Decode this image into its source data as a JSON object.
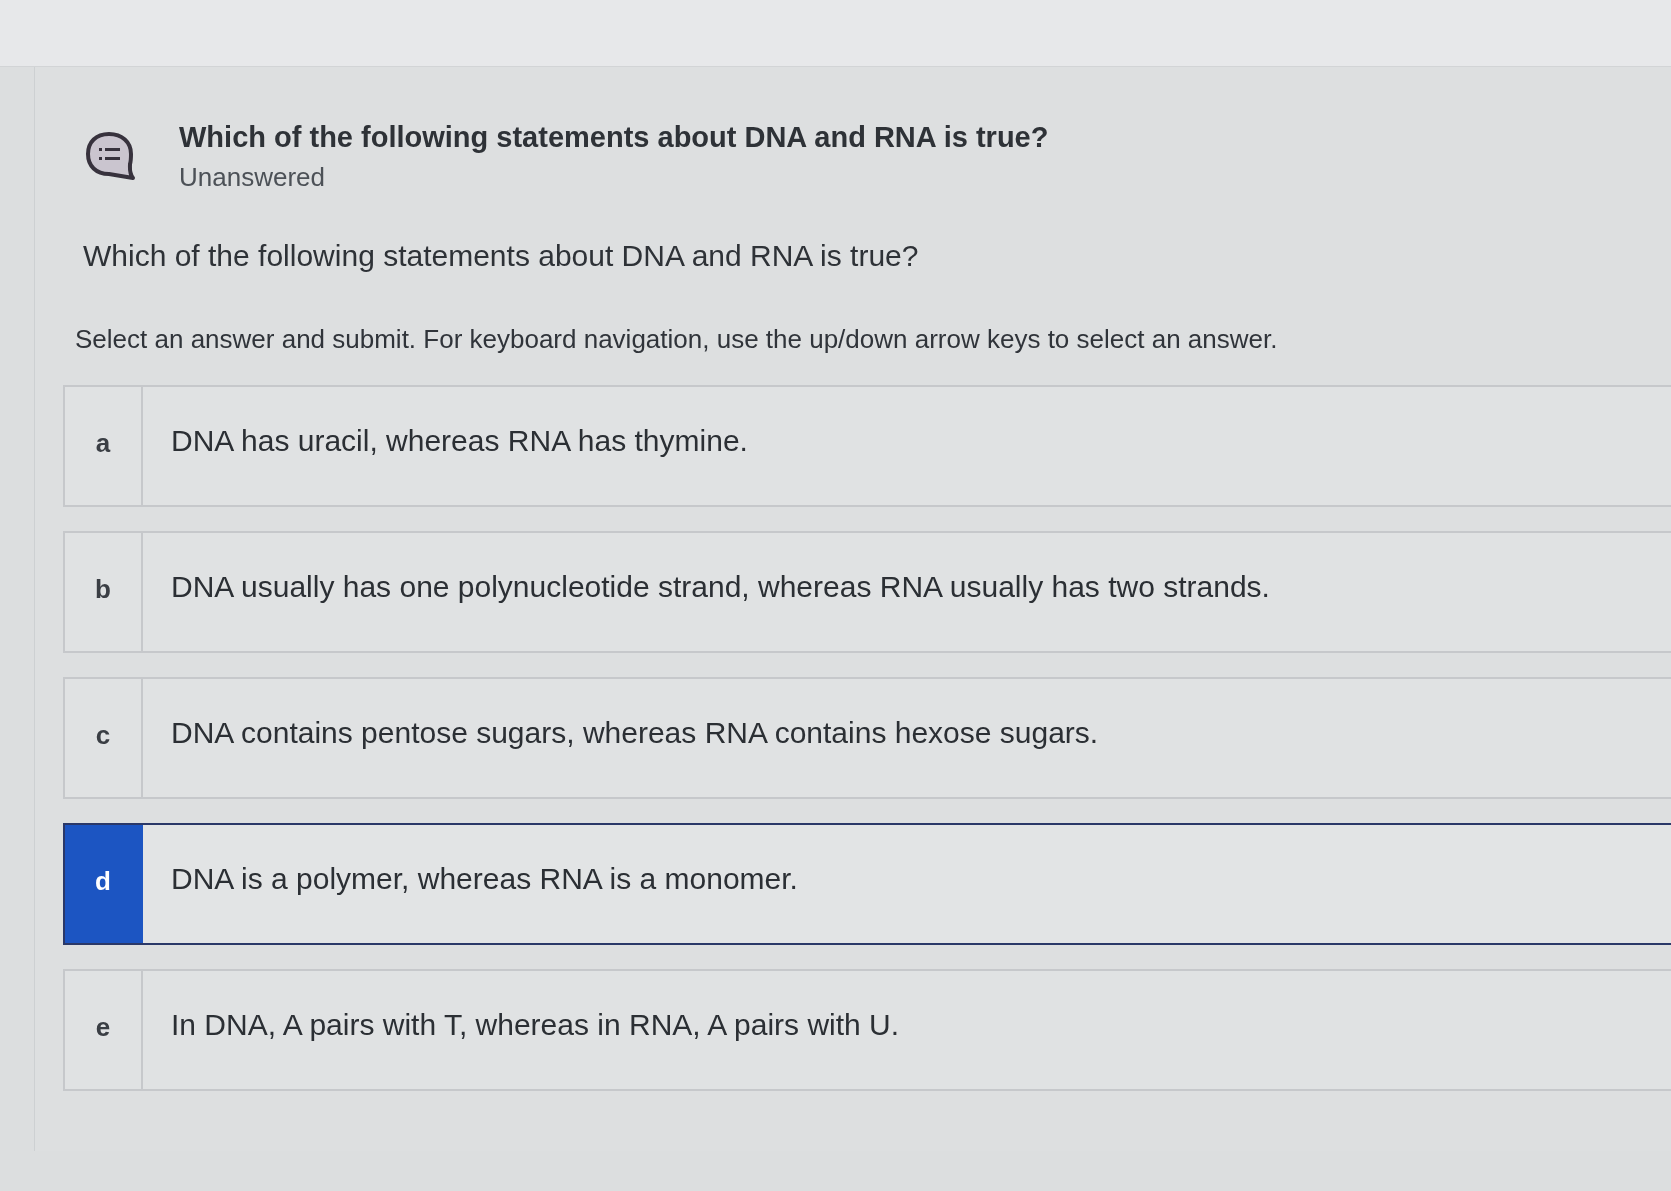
{
  "header": {
    "title": "Which of the following statements about DNA and RNA is true?",
    "status": "Unanswered"
  },
  "question": "Which of the following statements about DNA and RNA is true?",
  "instructions": "Select an answer and submit. For keyboard navigation, use the up/down arrow keys to select an answer.",
  "options": [
    {
      "letter": "a",
      "text": "DNA has uracil, whereas RNA has thymine.",
      "selected": false
    },
    {
      "letter": "b",
      "text": "DNA usually has one polynucleotide strand, whereas RNA usually has two strands.",
      "selected": false
    },
    {
      "letter": "c",
      "text": "DNA contains pentose sugars, whereas RNA contains hexose sugars.",
      "selected": false
    },
    {
      "letter": "d",
      "text": "DNA is a polymer, whereas RNA is a monomer.",
      "selected": true
    },
    {
      "letter": "e",
      "text": "In DNA, A pairs with T, whereas in RNA, A pairs with U.",
      "selected": false
    }
  ]
}
